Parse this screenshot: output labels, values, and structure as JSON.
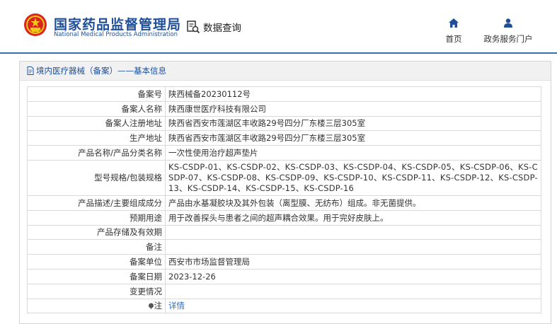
{
  "header": {
    "title": "国家药品监督管理局",
    "subtitle": "National Medical Products Administration",
    "data_query": "数据查询",
    "nav": [
      {
        "label": "首页",
        "icon": "home-icon"
      },
      {
        "label": "政务服务门户",
        "icon": "user-icon"
      }
    ]
  },
  "panel": {
    "title": "境内医疗器械（备案）——基本信息"
  },
  "record": {
    "rows": [
      {
        "key": "备案号",
        "value": "陕西械备20230112号"
      },
      {
        "key": "备案人名称",
        "value": "陕西康世医疗科技有限公司"
      },
      {
        "key": "备案人注册地址",
        "value": "陕西省西安市莲湖区丰收路29号四分厂东楼三层305室"
      },
      {
        "key": "生产地址",
        "value": "陕西省西安市莲湖区丰收路29号四分厂东楼三层305室"
      },
      {
        "key": "产品名称/产品分类名称",
        "value": "一次性使用治疗超声垫片"
      },
      {
        "key": "型号规格/包装规格",
        "value": "KS-CSDP-01、KS-CSDP-02、KS-CSDP-03、KS-CSDP-04、KS-CSDP-05、KS-CSDP-06、KS-CSDP-07、KS-CSDP-08、KS-CSDP-09、KS-CSDP-10、KS-CSDP-11、KS-CSDP-12、KS-CSDP-13、KS-CSDP-14、KS-CSDP-15、KS-CSDP-16"
      },
      {
        "key": "产品描述/主要组成成分",
        "value": "产品由水基凝胶块及其外包装（离型膜、无纺布）组成。非无菌提供。"
      },
      {
        "key": "预期用途",
        "value": "用于改善探头与患者之间的超声耦合效果。用于完好皮肤上。"
      },
      {
        "key": "产品存储及有效期",
        "value": ""
      },
      {
        "key": "备注",
        "value": ""
      },
      {
        "key": "备案单位",
        "value": "西安市市场监督管理局"
      },
      {
        "key": "备案日期",
        "value": "2023-12-26"
      },
      {
        "key": "变更情况",
        "value": ""
      },
      {
        "key": "注",
        "value": "详情"
      }
    ]
  }
}
